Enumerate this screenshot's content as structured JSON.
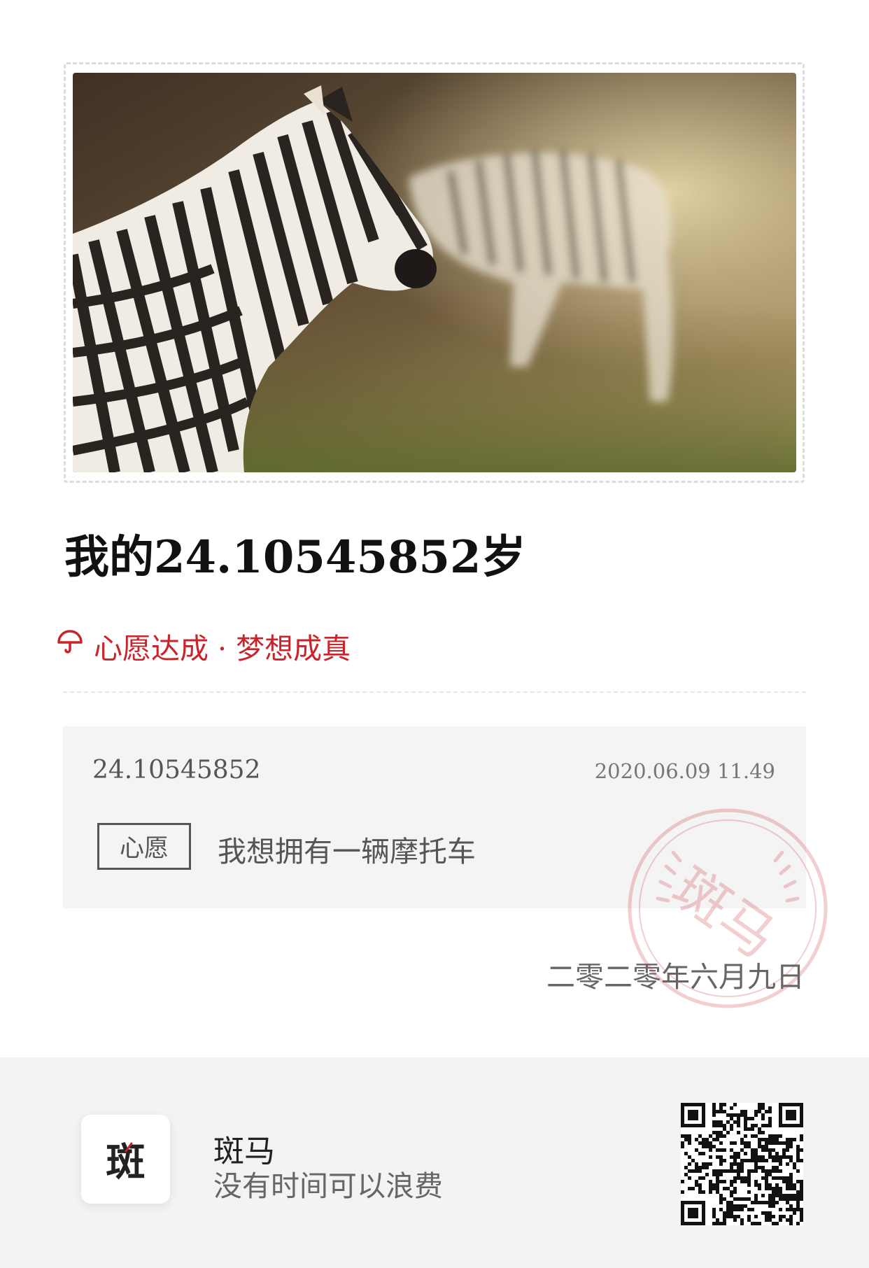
{
  "post": {
    "title": "我的24.10545852岁",
    "tagline": "心愿达成 · 梦想成真"
  },
  "wish_card": {
    "age": "24.10545852",
    "datetime": "2020.06.09 11.49",
    "tag_label": "心愿",
    "wish_text": "我想拥有一辆摩托车"
  },
  "stamp": {
    "text": "斑马"
  },
  "date_cn": "二零二零年六月九日",
  "footer": {
    "app_icon_glyph": "斑",
    "app_name": "斑马",
    "slogan": "没有时间可以浪费"
  },
  "colors": {
    "accent_red": "#c8242c",
    "card_bg": "#f4f4f4",
    "footer_bg": "#f3f3f3"
  },
  "icons": {
    "tagline_icon": "umbrella-icon"
  }
}
